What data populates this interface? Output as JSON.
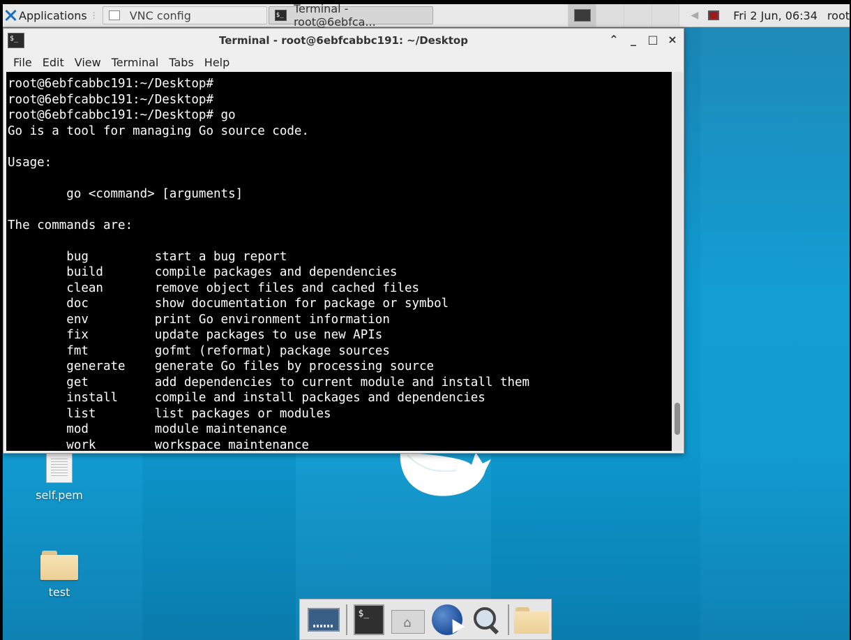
{
  "panel": {
    "applications_label": "Applications",
    "tasks": [
      {
        "label": "VNC config",
        "active": false
      },
      {
        "label": "Terminal - root@6ebfca...",
        "active": true
      }
    ],
    "clock": "Fri  2 Jun, 06:34",
    "user": "root"
  },
  "window": {
    "title": "Terminal - root@6ebfcabbc191: ~/Desktop",
    "controls": {
      "shade": "⌃",
      "minimize": "_",
      "maximize": "□",
      "close": "×"
    },
    "menu": [
      "File",
      "Edit",
      "View",
      "Terminal",
      "Tabs",
      "Help"
    ]
  },
  "terminal": {
    "lines": [
      "root@6ebfcabbc191:~/Desktop#",
      "root@6ebfcabbc191:~/Desktop#",
      "root@6ebfcabbc191:~/Desktop# go",
      "Go is a tool for managing Go source code.",
      "",
      "Usage:",
      "",
      "        go <command> [arguments]",
      "",
      "The commands are:",
      "",
      "        bug         start a bug report",
      "        build       compile packages and dependencies",
      "        clean       remove object files and cached files",
      "        doc         show documentation for package or symbol",
      "        env         print Go environment information",
      "        fix         update packages to use new APIs",
      "        fmt         gofmt (reformat) package sources",
      "        generate    generate Go files by processing source",
      "        get         add dependencies to current module and install them",
      "        install     compile and install packages and dependencies",
      "        list        list packages or modules",
      "        mod         module maintenance",
      "        work        workspace maintenance"
    ]
  },
  "desktop": {
    "icons": [
      {
        "label": "self.pem",
        "icon": "file-icon"
      },
      {
        "label": "test",
        "icon": "folder-icon"
      }
    ]
  },
  "dock": {
    "items": [
      "show-desktop-icon",
      "terminal-icon",
      "home-folder-icon",
      "web-browser-icon",
      "search-icon",
      "file-manager-icon"
    ]
  }
}
